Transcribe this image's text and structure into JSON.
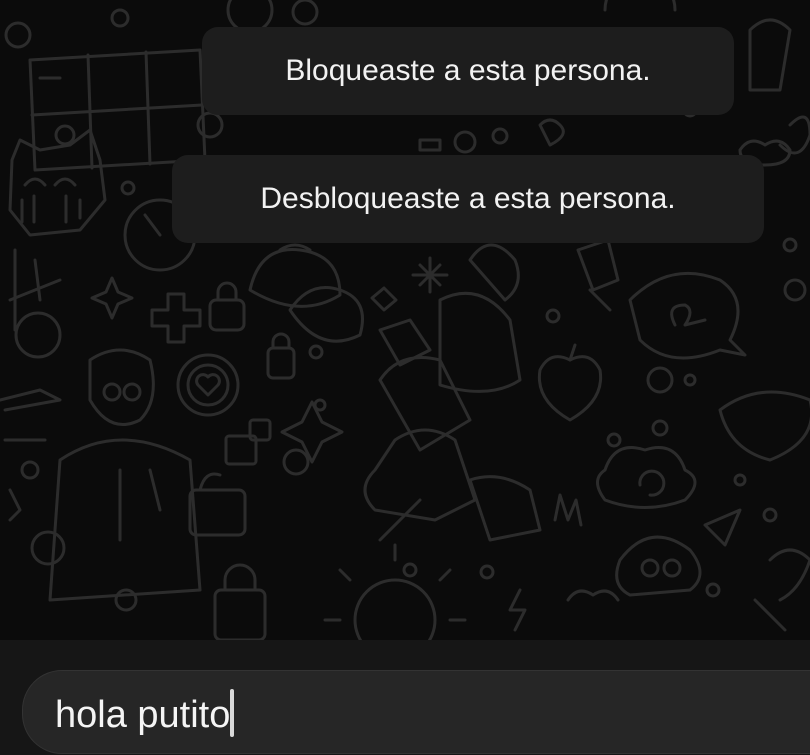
{
  "chat": {
    "system_messages": [
      {
        "text": "Bloqueaste a esta persona."
      },
      {
        "text": "Desbloqueaste a esta persona."
      }
    ],
    "wallpaper": {
      "pattern": "doodle-pattern",
      "color": "#2a2a2a"
    }
  },
  "composer": {
    "input_value": "hola putito",
    "background": "#262626"
  },
  "theme": {
    "background": "#0b0b0b",
    "bubble": "#1d1d1d",
    "text": "#f2f2f2"
  }
}
